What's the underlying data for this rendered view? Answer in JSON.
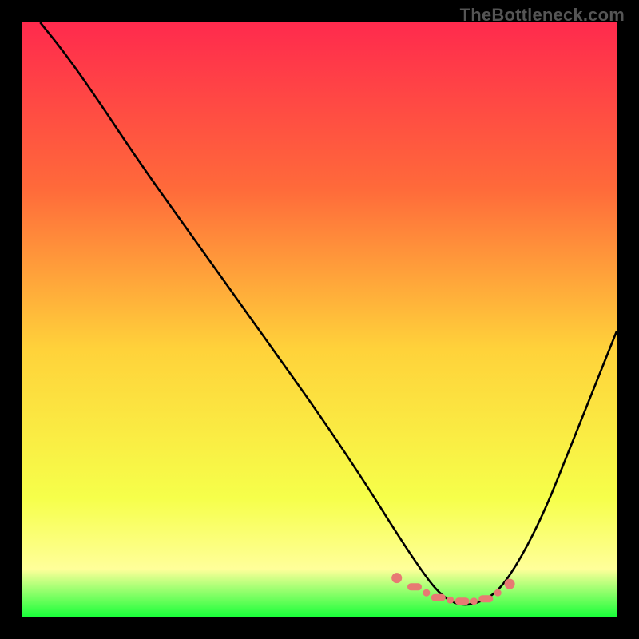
{
  "watermark": "TheBottleneck.com",
  "colors": {
    "frame": "#000000",
    "curve": "#000000",
    "accent": "#e77a73",
    "gradient_top": "#ff2a4d",
    "gradient_mid_upper": "#ff6a3a",
    "gradient_mid": "#ffd23a",
    "gradient_lower": "#f6ff4a",
    "gradient_band": "#ffff9a",
    "gradient_bottom": "#1aff3a"
  },
  "chart_data": {
    "type": "line",
    "title": "",
    "xlabel": "",
    "ylabel": "",
    "xlim": [
      0,
      100
    ],
    "ylim": [
      0,
      100
    ],
    "series": [
      {
        "name": "bottleneck-curve",
        "x": [
          3,
          7,
          12,
          20,
          30,
          40,
          50,
          58,
          63,
          67,
          70,
          73,
          76,
          80,
          84,
          88,
          92,
          96,
          100
        ],
        "y": [
          100,
          95,
          88,
          76,
          62,
          48,
          34,
          22,
          14,
          8,
          4,
          2,
          2,
          4,
          10,
          18,
          28,
          38,
          48
        ]
      }
    ],
    "accent_points": {
      "name": "optimal-markers",
      "x": [
        63,
        66,
        68,
        70,
        72,
        74,
        76,
        78,
        80,
        82
      ],
      "y": [
        6.5,
        5.0,
        4.0,
        3.2,
        2.8,
        2.6,
        2.6,
        3.0,
        4.0,
        5.5
      ]
    },
    "valley_x": 75
  }
}
